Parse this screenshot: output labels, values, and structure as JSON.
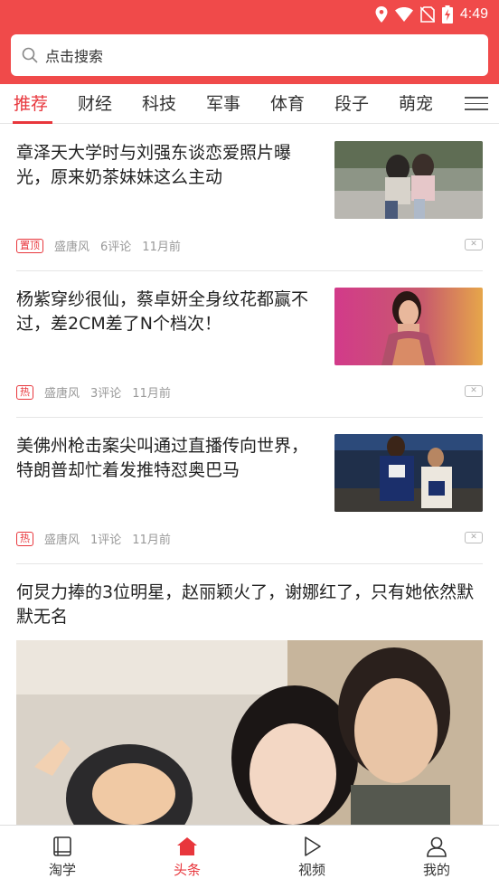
{
  "status_bar": {
    "time": "4:49",
    "icons": [
      "location-icon",
      "wifi-icon",
      "no-sim-icon",
      "battery-charging-icon"
    ]
  },
  "search": {
    "placeholder": "点击搜索"
  },
  "tabs": [
    {
      "label": "推荐",
      "active": true
    },
    {
      "label": "财经",
      "active": false
    },
    {
      "label": "科技",
      "active": false
    },
    {
      "label": "军事",
      "active": false
    },
    {
      "label": "体育",
      "active": false
    },
    {
      "label": "段子",
      "active": false
    },
    {
      "label": "萌宠",
      "active": false
    }
  ],
  "articles": [
    {
      "title": "章泽天大学时与刘强东谈恋爱照片曝光，原来奶茶妹妹这么主动",
      "badge": "置顶",
      "source": "盛唐风",
      "comments": "6评论",
      "time": "11月前"
    },
    {
      "title": "杨紫穿纱很仙，蔡卓妍全身纹花都赢不过，差2CM差了N个档次！",
      "badge": "热",
      "source": "盛唐风",
      "comments": "3评论",
      "time": "11月前"
    },
    {
      "title": "美佛州枪击案尖叫通过直播传向世界，特朗普却忙着发推特怼奥巴马",
      "badge": "热",
      "source": "盛唐风",
      "comments": "1评论",
      "time": "11月前"
    },
    {
      "title": "何炅力捧的3位明星，赵丽颖火了，谢娜红了，只有她依然默默无名"
    }
  ],
  "bottom_nav": [
    {
      "label": "淘学",
      "icon": "book-icon",
      "active": false
    },
    {
      "label": "头条",
      "icon": "home-icon",
      "active": true
    },
    {
      "label": "视频",
      "icon": "play-icon",
      "active": false
    },
    {
      "label": "我的",
      "icon": "user-icon",
      "active": false
    }
  ],
  "colors": {
    "brand_red": "#f04a4a",
    "accent_red": "#e8363c"
  }
}
